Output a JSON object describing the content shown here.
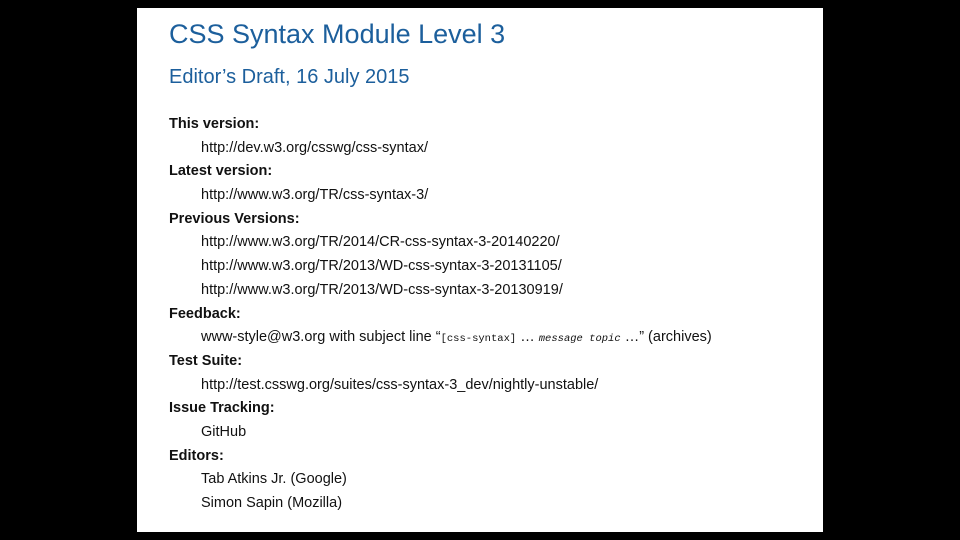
{
  "header": {
    "title": "CSS Syntax Module Level 3",
    "subtitle": "Editor’s Draft, 16 July 2015"
  },
  "metadata": {
    "this_version": {
      "label": "This version:",
      "url": "http://dev.w3.org/csswg/css-syntax/"
    },
    "latest_version": {
      "label": "Latest version:",
      "url": "http://www.w3.org/TR/css-syntax-3/"
    },
    "previous_versions": {
      "label": "Previous Versions:",
      "urls": [
        "http://www.w3.org/TR/2014/CR-css-syntax-3-20140220/",
        "http://www.w3.org/TR/2013/WD-css-syntax-3-20131105/",
        "http://www.w3.org/TR/2013/WD-css-syntax-3-20130919/"
      ]
    },
    "feedback": {
      "label": "Feedback:",
      "email": "www-style@w3.org",
      "text_before": " with subject line “",
      "tag": "[css-syntax]",
      "ellipsis_1": " … ",
      "topic": "message topic",
      "ellipsis_2": " …",
      "text_after": "” (",
      "archives_link": "archives",
      "close_paren": ")"
    },
    "test_suite": {
      "label": "Test Suite:",
      "url": "http://test.csswg.org/suites/css-syntax-3_dev/nightly-unstable/"
    },
    "issue_tracking": {
      "label": "Issue Tracking:",
      "value": "GitHub"
    },
    "editors": {
      "label": "Editors:",
      "names": [
        "Tab Atkins Jr. (Google)",
        "Simon Sapin (Mozilla)"
      ]
    }
  },
  "colors": {
    "title": "#1c5f9c",
    "background": "#000000",
    "page": "#ffffff",
    "text": "#111111"
  }
}
